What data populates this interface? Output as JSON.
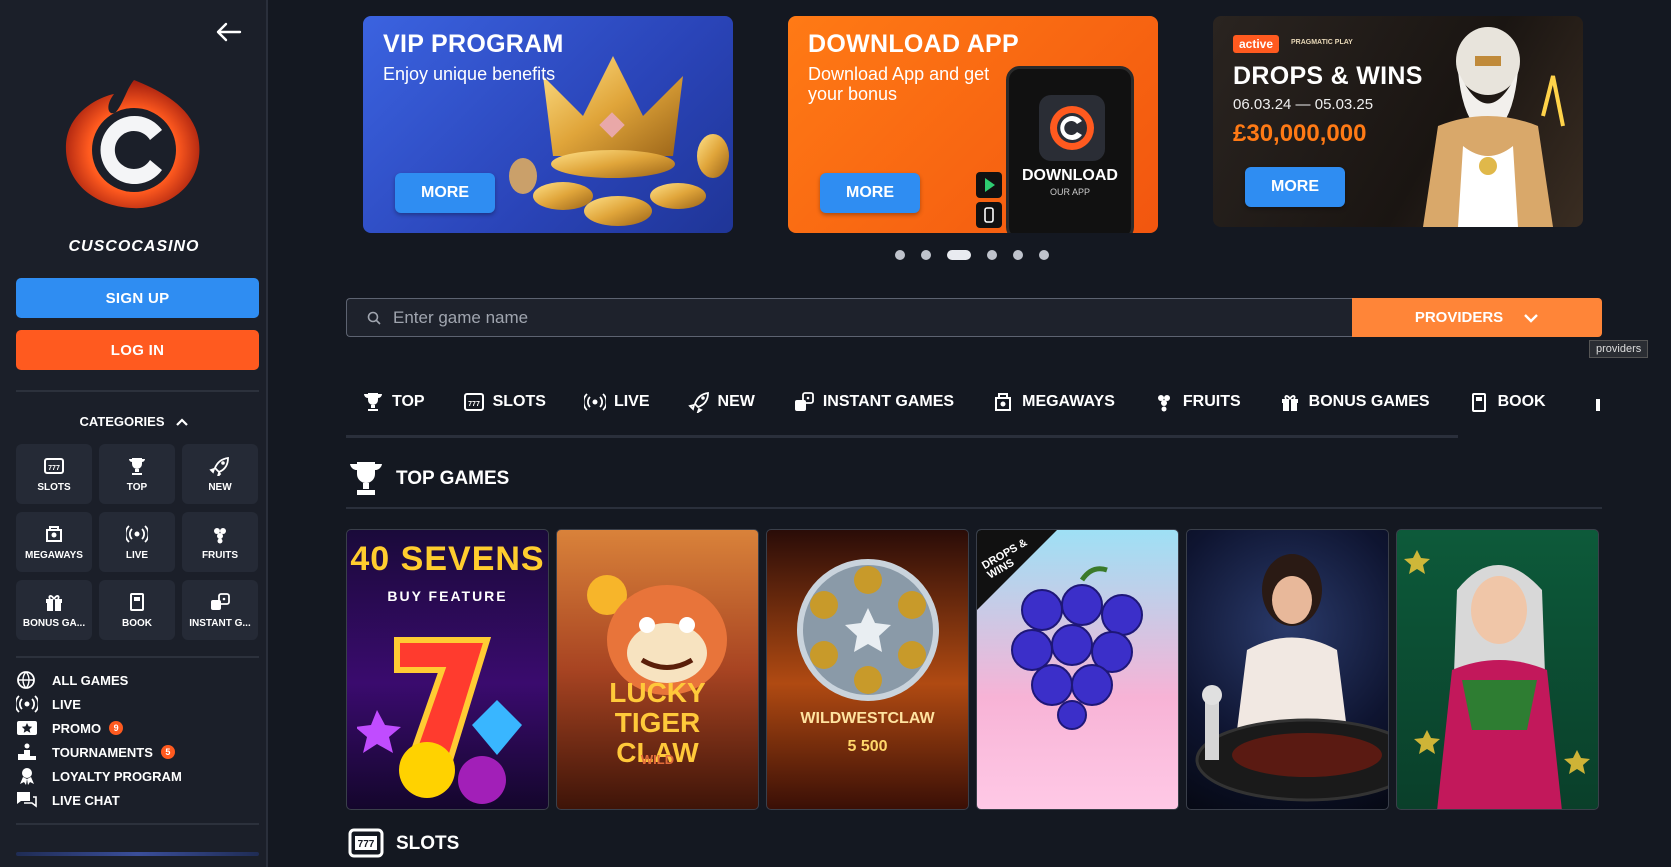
{
  "sidebar": {
    "brand": "CUSCOCASINO",
    "signup_label": "SIGN UP",
    "login_label": "LOG IN",
    "categories_label": "CATEGORIES",
    "category_tiles": [
      {
        "label": "SLOTS",
        "icon": "slots-icon"
      },
      {
        "label": "TOP",
        "icon": "trophy-icon"
      },
      {
        "label": "NEW",
        "icon": "rocket-icon"
      },
      {
        "label": "MEGAWAYS",
        "icon": "megaways-icon"
      },
      {
        "label": "LIVE",
        "icon": "live-icon"
      },
      {
        "label": "FRUITS",
        "icon": "fruits-icon"
      },
      {
        "label": "BONUS GA...",
        "icon": "gift-icon"
      },
      {
        "label": "BOOK",
        "icon": "book-icon"
      },
      {
        "label": "INSTANT G...",
        "icon": "dice-icon"
      }
    ],
    "nav": [
      {
        "label": "ALL GAMES",
        "icon": "globe-icon",
        "badge": ""
      },
      {
        "label": "LIVE",
        "icon": "live-icon",
        "badge": ""
      },
      {
        "label": "PROMO",
        "icon": "promo-icon",
        "badge": "9"
      },
      {
        "label": "TOURNAMENTS",
        "icon": "podium-icon",
        "badge": "5"
      },
      {
        "label": "LOYALTY PROGRAM",
        "icon": "loyalty-icon",
        "badge": ""
      },
      {
        "label": "LIVE CHAT",
        "icon": "chat-icon",
        "badge": ""
      }
    ]
  },
  "banners": {
    "vip": {
      "title": "VIP PROGRAM",
      "subtitle": "Enjoy unique benefits",
      "button": "MORE"
    },
    "app": {
      "title": "DOWNLOAD APP",
      "subtitle": "Download App and get your bonus",
      "button": "MORE",
      "phone_title": "DOWNLOAD",
      "phone_sub": "OUR APP"
    },
    "drops": {
      "tag": "active",
      "provider": "PRAGMATIC PLAY",
      "title": "DROPS & WINS",
      "dates": "06.03.24 — 05.03.25",
      "prize": "£30,000,000",
      "button": "MORE"
    }
  },
  "carousel": {
    "count": 6,
    "active": 2
  },
  "search": {
    "placeholder": "Enter game name",
    "providers_label": "PROVIDERS",
    "tooltip": "providers"
  },
  "tabs": [
    {
      "label": "TOP",
      "icon": "trophy-icon"
    },
    {
      "label": "SLOTS",
      "icon": "slots-icon"
    },
    {
      "label": "LIVE",
      "icon": "live-icon"
    },
    {
      "label": "NEW",
      "icon": "rocket-icon"
    },
    {
      "label": "INSTANT GAMES",
      "icon": "dice-icon"
    },
    {
      "label": "MEGAWAYS",
      "icon": "megaways-icon"
    },
    {
      "label": "FRUITS",
      "icon": "fruits-icon"
    },
    {
      "label": "BONUS GAMES",
      "icon": "gift-icon"
    },
    {
      "label": "BOOK",
      "icon": "book-icon"
    }
  ],
  "sections": {
    "top_games": "TOP GAMES",
    "slots": "SLOTS"
  },
  "games": [
    {
      "title": "40 SEVENS",
      "sub": "BUY FEATURE"
    },
    {
      "title": "LUCKY TIGER CLAW",
      "sub": "WILD"
    },
    {
      "title": "WILDWESTCLAW",
      "sub": "5 500"
    },
    {
      "title": "",
      "sub": "DROPS & WINS"
    },
    {
      "title": "",
      "sub": ""
    },
    {
      "title": "",
      "sub": ""
    }
  ],
  "colors": {
    "primary_blue": "#2f8df2",
    "accent_orange": "#ff5a1f",
    "providers_orange": "#ff8538",
    "sidebar_bg": "#1b1f29",
    "page_bg": "#141821"
  }
}
